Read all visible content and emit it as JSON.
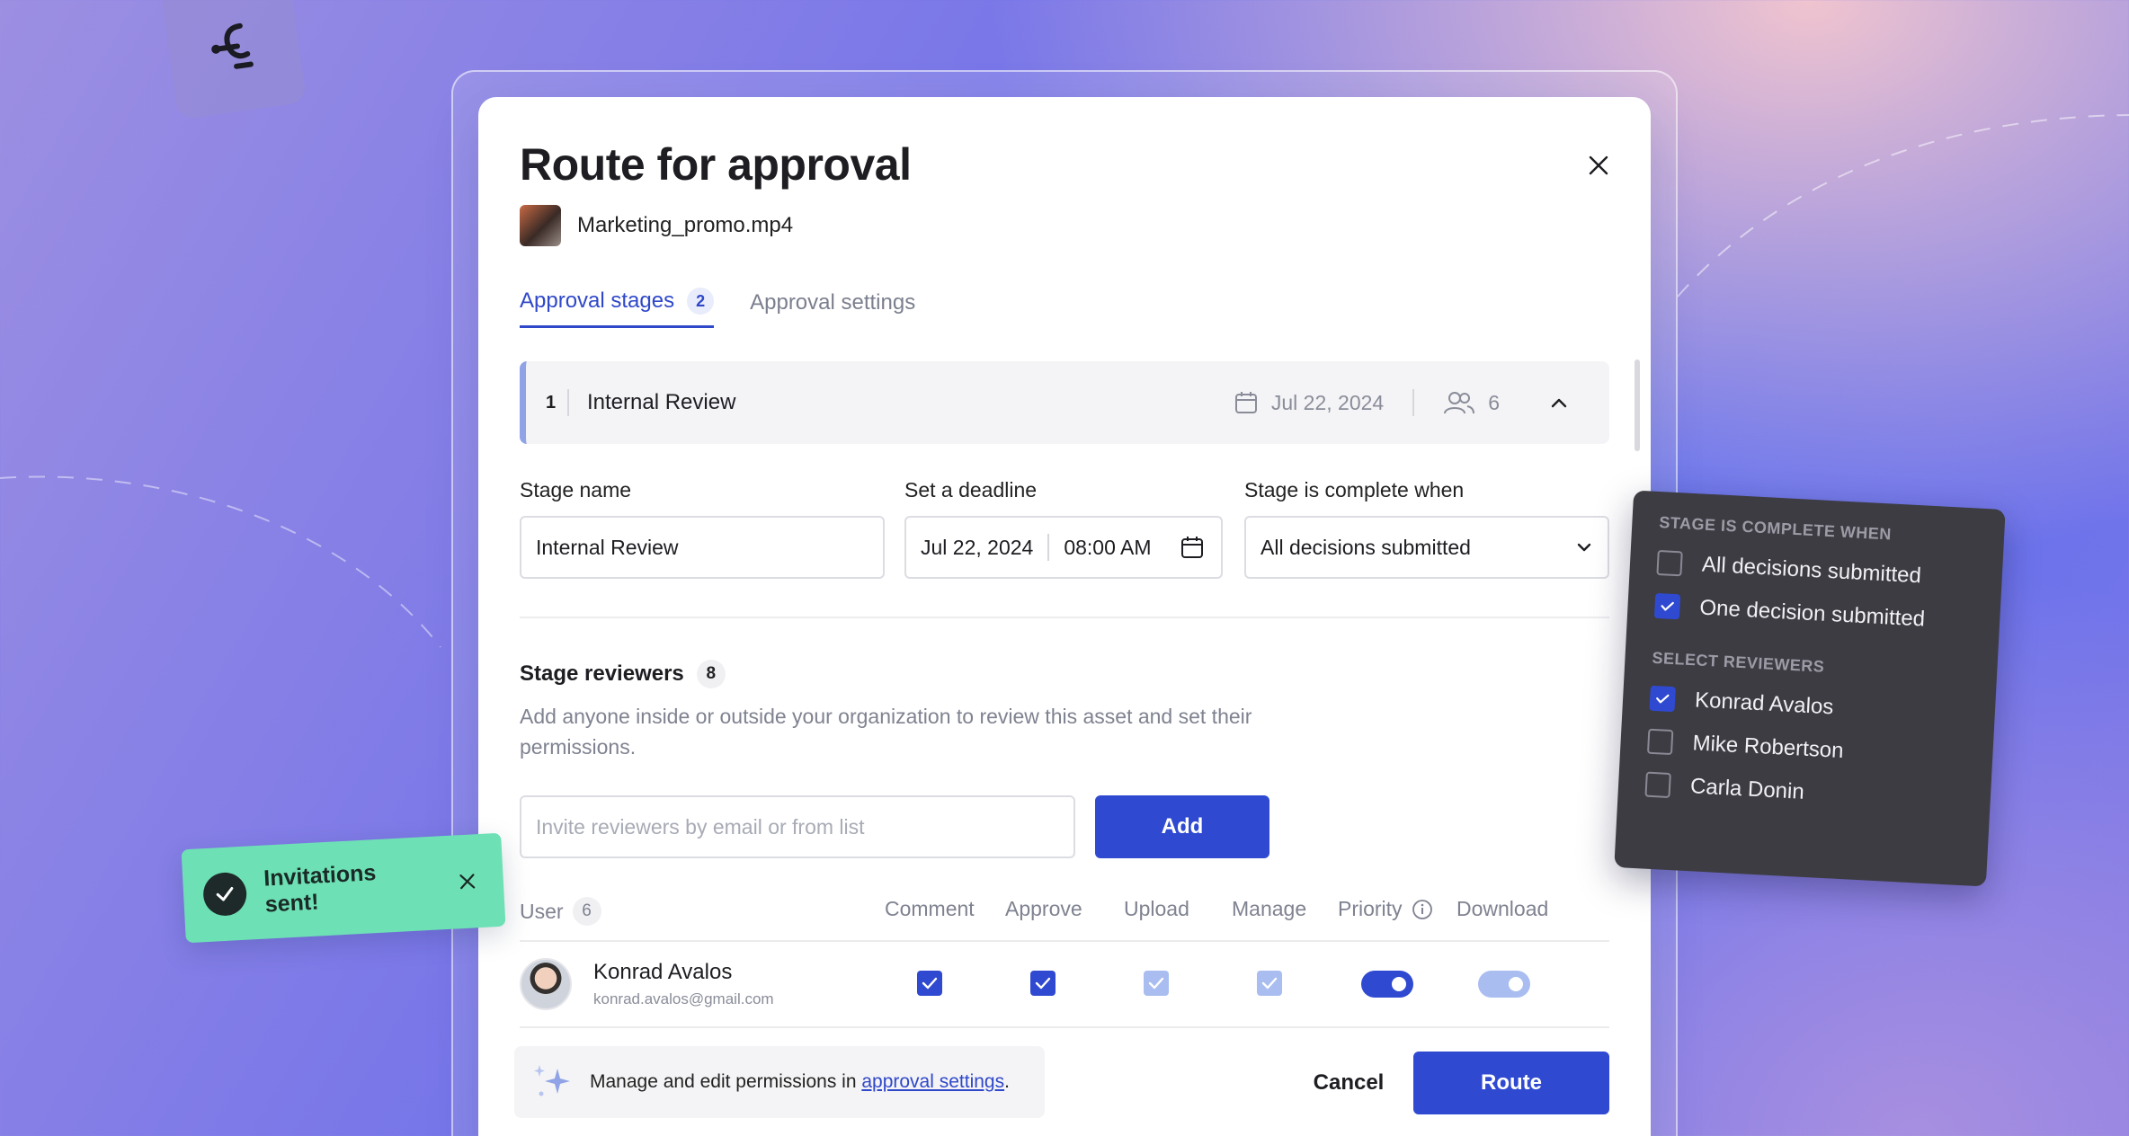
{
  "modal": {
    "title": "Route for approval",
    "file_name": "Marketing_promo.mp4",
    "tabs": [
      {
        "label": "Approval stages",
        "badge": "2",
        "active": true
      },
      {
        "label": "Approval settings",
        "active": false
      }
    ]
  },
  "stage": {
    "number": "1",
    "name": "Internal Review",
    "date": "Jul 22, 2024",
    "reviewer_count": "6"
  },
  "form": {
    "stage_name_label": "Stage name",
    "stage_name_value": "Internal Review",
    "deadline_label": "Set a deadline",
    "deadline_date": "Jul 22, 2024",
    "deadline_time": "08:00 AM",
    "complete_label": "Stage is complete when",
    "complete_value": "All decisions submitted"
  },
  "reviewers": {
    "title": "Stage reviewers",
    "count": "8",
    "description": "Add anyone inside or outside your organization to review this asset and set their permissions.",
    "invite_placeholder": "Invite reviewers by email or from list",
    "add_label": "Add"
  },
  "table": {
    "user_header": "User",
    "user_count": "6",
    "columns": [
      "Comment",
      "Approve",
      "Upload",
      "Manage",
      "Priority",
      "Download"
    ],
    "rows": [
      {
        "name": "Konrad Avalos",
        "email": "konrad.avalos@gmail.com",
        "comment": "checked",
        "approve": "checked",
        "upload": "checked-disabled",
        "manage": "checked-disabled",
        "priority": "on",
        "download": "on-disabled"
      }
    ]
  },
  "footer": {
    "hint_prefix": "Manage and edit permissions in ",
    "hint_link": "approval settings",
    "hint_suffix": ".",
    "cancel_label": "Cancel",
    "route_label": "Route"
  },
  "toast": {
    "text": "Invitations sent!"
  },
  "dropdown_panel": {
    "heading_complete": "STAGE IS COMPLETE WHEN",
    "complete_options": [
      {
        "label": "All decisions submitted",
        "checked": false
      },
      {
        "label": "One decision submitted",
        "checked": true
      }
    ],
    "heading_reviewers": "SELECT REVIEWERS",
    "reviewer_options": [
      {
        "label": "Konrad Avalos",
        "checked": true
      },
      {
        "label": "Mike Robertson",
        "checked": false
      },
      {
        "label": "Carla Donin",
        "checked": false
      }
    ]
  },
  "colors": {
    "accent": "#2f4ad1",
    "toast_bg": "#6ee0b5",
    "panel_bg": "#3d3c43"
  }
}
